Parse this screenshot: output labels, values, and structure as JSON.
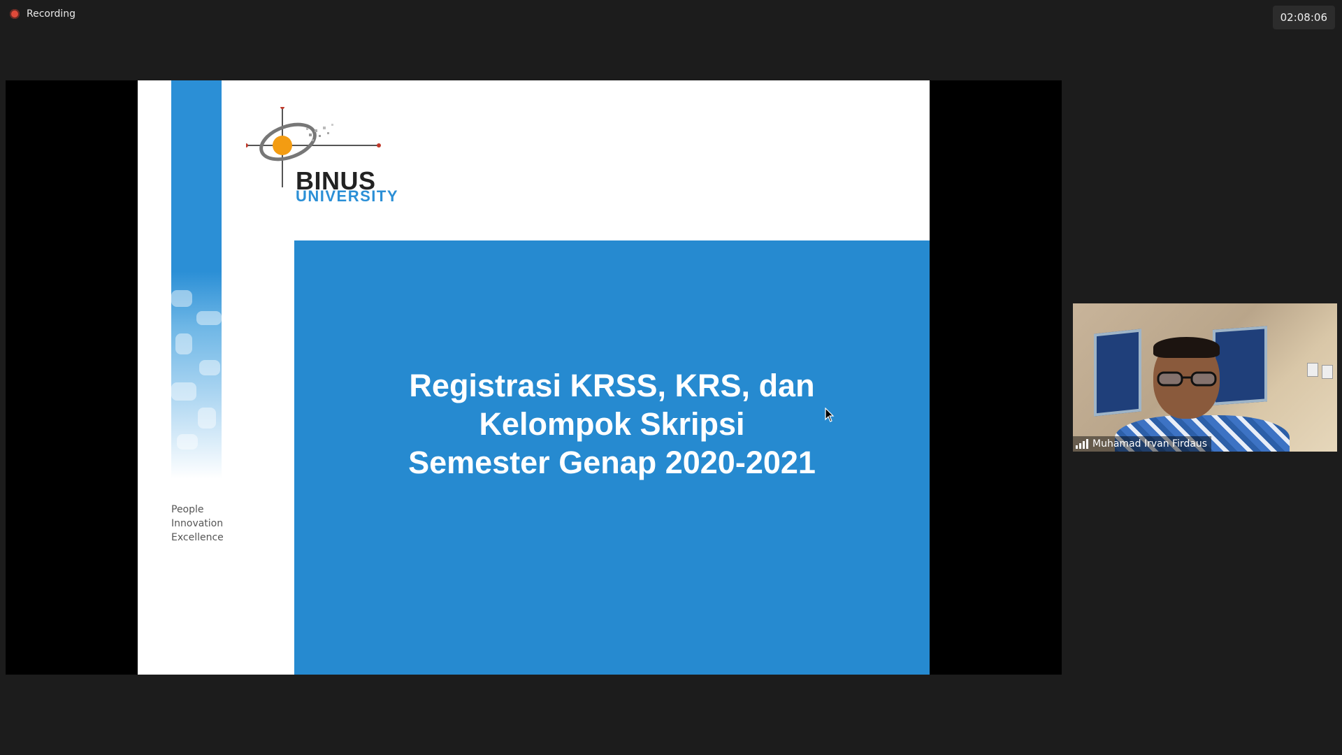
{
  "recording": {
    "label": "Recording",
    "dot_color": "#e04a3a"
  },
  "timer": {
    "value": "02:08:06"
  },
  "slide": {
    "logo_binus": "BINUS",
    "logo_university": "UNIVERSITY",
    "tagline": [
      "People",
      "Innovation",
      "Excellence"
    ],
    "title_lines": [
      "Registrasi KRSS, KRS, dan",
      "Kelompok Skripsi",
      "Semester Genap 2020-2021"
    ],
    "accent_color": "#268ad0"
  },
  "participant": {
    "name": "Muhamad Irvan Firdaus",
    "signal_icon": "signal-bars-icon"
  }
}
